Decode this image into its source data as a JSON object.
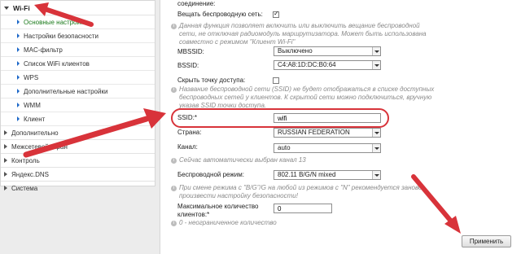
{
  "sidebar": {
    "wifi_label": "Wi-Fi",
    "sub_items": [
      {
        "label": "Основные настройки",
        "active": true
      },
      {
        "label": "Настройки безопасности"
      },
      {
        "label": "MAC-фильтр"
      },
      {
        "label": "Список WiFi клиентов"
      },
      {
        "label": "WPS"
      },
      {
        "label": "Дополнительные настройки"
      },
      {
        "label": "WMM"
      },
      {
        "label": "Клиент"
      }
    ],
    "top_items": [
      {
        "label": "Дополнительно"
      },
      {
        "label": "Межсетевой экран"
      },
      {
        "label": "Контроль"
      },
      {
        "label": "Яндекс.DNS"
      },
      {
        "label": "Система"
      }
    ]
  },
  "form": {
    "connection_label": "соединение:",
    "broadcast_label": "Вещать беспроводную сеть:",
    "broadcast_checked": true,
    "broadcast_hint_1": "Данная функция позволяет включить или выключить вещание беспроводной",
    "broadcast_hint_2": "сети, не отключая радиомодуль маршрутизатора. Может быть использована",
    "broadcast_hint_3": "совместно с режимом \"Клиент Wi-Fi\"",
    "mbssid_label": "MBSSID:",
    "mbssid_value": "Выключено",
    "bssid_label": "BSSID:",
    "bssid_value": "C4:A8:1D:DC:B0:64",
    "hide_ap_label": "Скрыть точку доступа:",
    "hide_ap_checked": false,
    "hide_hint_1": "Название беспроводной сети (SSID) не будет отображаться в списке доступных",
    "hide_hint_2": "беспроводных сетей у клиентов. К скрытой сети можно подключиться, вручную",
    "hide_hint_3": "указав SSID точки доступа.",
    "ssid_label": "SSID:*",
    "ssid_value": "wifi",
    "country_label": "Страна:",
    "country_value": "RUSSIAN FEDERATION",
    "channel_label": "Канал:",
    "channel_value": "auto",
    "channel_hint": "Сейчас автоматически выбран канал 13",
    "mode_label": "Беспроводной режим:",
    "mode_value": "802.11 B/G/N mixed",
    "mode_hint_1": "При смене режима с \"B/G\"/G на любой из режимов с \"N\" рекомендуется заново",
    "mode_hint_2": "произвести настройку безопасности!",
    "max_clients_label_1": "Максимальное количество",
    "max_clients_label_2": "клиентов:*",
    "max_clients_value": "0",
    "max_clients_hint": "0 - неограниченное количество",
    "apply_label": "Применить"
  },
  "colors": {
    "annotation_red": "#d8333a",
    "active_item": "#1b7a1b",
    "submenu_bullet": "#1a66c8"
  }
}
